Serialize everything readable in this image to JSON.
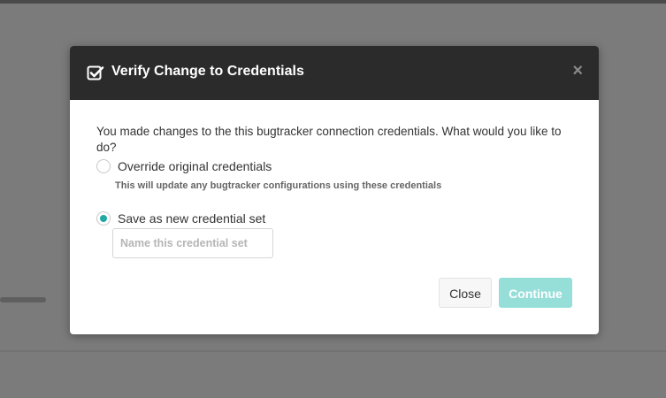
{
  "dialog": {
    "title": "Verify Change to Credentials",
    "title_icon": "check-square-icon",
    "close_symbol": "×",
    "prompt": "You made changes to the this bugtracker connection credentials. What would you like to do?",
    "options": [
      {
        "label": "Override original credentials",
        "help": "This will update any bugtracker configurations using these credentials",
        "selected": false
      },
      {
        "label": "Save as new credential set",
        "selected": true
      }
    ],
    "name_input": {
      "value": "",
      "placeholder": "Name this credential set"
    },
    "buttons": {
      "close_label": "Close",
      "continue_label": "Continue"
    }
  },
  "colors": {
    "header_bg": "#2b2b2b",
    "accent": "#1ea9a5",
    "continue_disabled": "#96ded8",
    "backdrop": "#7b7b7b"
  }
}
